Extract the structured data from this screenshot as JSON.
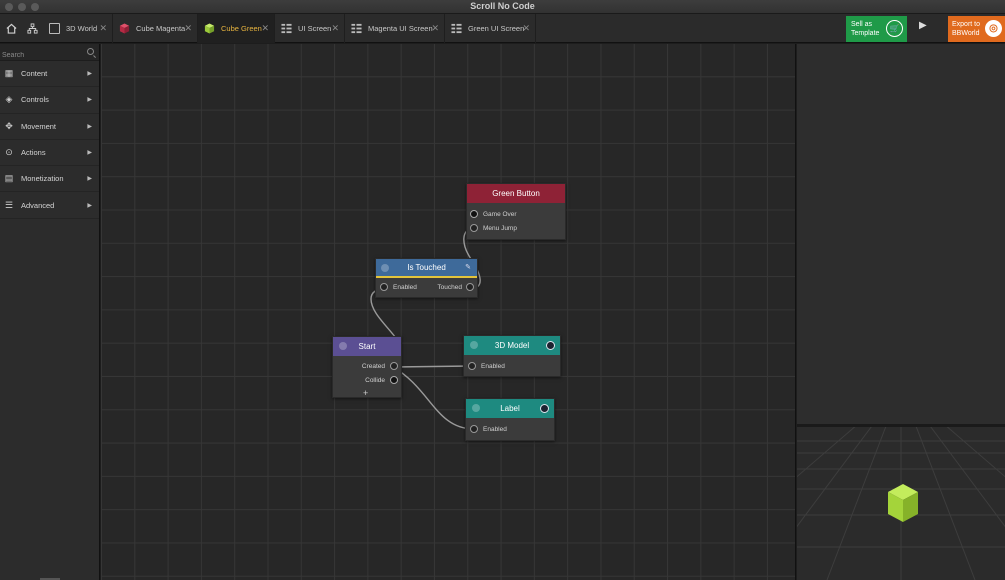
{
  "window": {
    "title": "Scroll No Code"
  },
  "toolbar": {
    "tabs": [
      {
        "label": "3D World",
        "icon": "grid-icon",
        "active": false
      },
      {
        "label": "Cube Magenta",
        "icon": "cube-magenta-icon",
        "active": false
      },
      {
        "label": "Cube Green",
        "icon": "cube-green-icon",
        "active": true
      },
      {
        "label": "UI Screen",
        "icon": "ui-screen-icon",
        "active": false
      },
      {
        "label": "Magenta UI Screen",
        "icon": "ui-screen-icon",
        "active": false
      },
      {
        "label": "Green UI Screen",
        "icon": "ui-screen-icon",
        "active": false
      }
    ],
    "sell_label_1": "Sell as",
    "sell_label_2": "Template",
    "export_label_1": "Export to",
    "export_label_2": "BBWorld"
  },
  "sidebar": {
    "search_placeholder": "Search",
    "categories": [
      {
        "label": "Content",
        "icon": "content-icon"
      },
      {
        "label": "Controls",
        "icon": "controls-icon"
      },
      {
        "label": "Movement",
        "icon": "movement-icon"
      },
      {
        "label": "Actions",
        "icon": "actions-icon"
      },
      {
        "label": "Monetization",
        "icon": "monetization-icon"
      },
      {
        "label": "Advanced",
        "icon": "advanced-icon"
      }
    ]
  },
  "nodes": {
    "green_button": {
      "title": "Green Button",
      "color": "#8e2236",
      "ports": [
        "Game Over",
        "Menu Jump"
      ]
    },
    "is_touched": {
      "title": "Is Touched",
      "color": "#3e6a9a",
      "in_label": "Enabled",
      "out_label": "Touched"
    },
    "start": {
      "title": "Start",
      "color": "#5b4f93",
      "ports": [
        "Created",
        "Collide"
      ],
      "add_label": "+"
    },
    "model3d": {
      "title": "3D Model",
      "color": "#1e8a80",
      "in_label": "Enabled"
    },
    "label": {
      "title": "Label",
      "color": "#1e8a80",
      "in_label": "Enabled"
    }
  },
  "colors": {
    "accent_tab": "#e6b33f",
    "sell": "#1f9a48",
    "export": "#e06a1e",
    "cube": "#a4d43a"
  }
}
